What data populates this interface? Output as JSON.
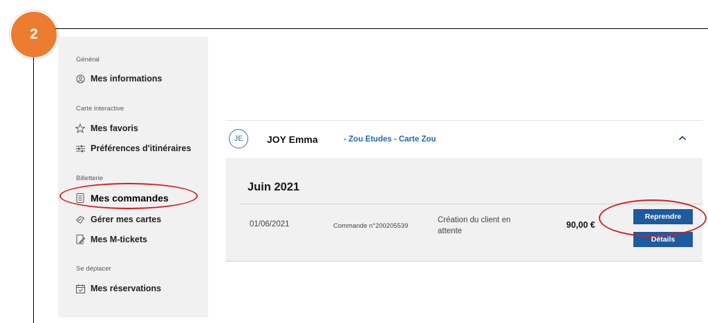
{
  "step": {
    "number": "2"
  },
  "sidebar": {
    "sections": [
      {
        "label": "Général"
      },
      {
        "label": "Carte interactive"
      },
      {
        "label": "Billetterie"
      },
      {
        "label": "Se déplacer"
      }
    ],
    "items": [
      {
        "label": "Mes informations",
        "icon": "user-circle-icon"
      },
      {
        "label": "Mes favoris",
        "icon": "star-icon"
      },
      {
        "label": "Préférences d'itinéraires",
        "icon": "sliders-icon"
      },
      {
        "label": "Mes commandes",
        "icon": "document-icon",
        "active": true
      },
      {
        "label": "Gérer mes cartes",
        "icon": "card-icon"
      },
      {
        "label": "Mes M-tickets",
        "icon": "ticket-icon"
      },
      {
        "label": "Mes réservations",
        "icon": "calendar-icon"
      }
    ]
  },
  "holder": {
    "initials": "JE",
    "name": "JOY Emma",
    "subscription": "- Zou Etudes - Carte Zou"
  },
  "orders": {
    "month": "Juin 2021",
    "rows": [
      {
        "date": "01/06/2021",
        "order": "Commande n°200205539",
        "status_line1": "Création du client en",
        "status_line2": "attente",
        "amount": "90,00 €",
        "resume_label": "Reprendre",
        "details_label": "Détails"
      }
    ]
  },
  "colors": {
    "badge": "#ec7c30",
    "link": "#2169b3",
    "button": "#1d5a9e",
    "highlight": "#d22020"
  }
}
